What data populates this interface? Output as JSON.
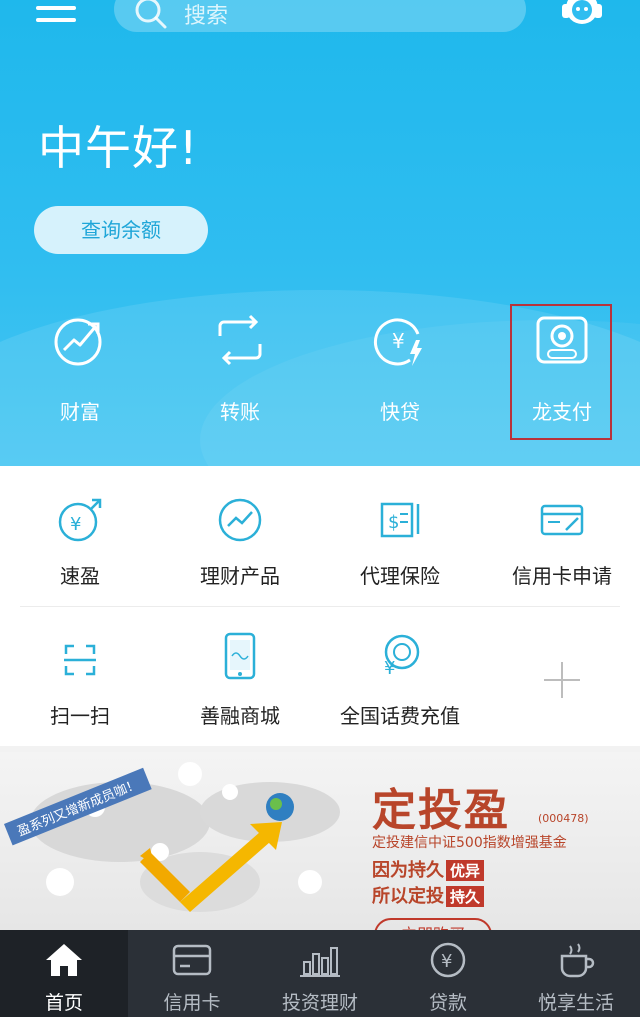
{
  "header": {
    "search_placeholder": "搜索",
    "menu_icon": "hamburger-menu-icon",
    "service_icon": "customer-service-icon"
  },
  "hero": {
    "greeting": "中午好!",
    "balance_button": "查询余额",
    "actions": [
      {
        "label": "财富",
        "icon": "wealth-growth-icon"
      },
      {
        "label": "转账",
        "icon": "transfer-icon"
      },
      {
        "label": "快贷",
        "icon": "quick-loan-icon"
      },
      {
        "label": "龙支付",
        "icon": "dragon-pay-icon",
        "highlighted": true
      }
    ]
  },
  "grid": {
    "row1": [
      {
        "label": "速盈",
        "icon": "su-ying-icon"
      },
      {
        "label": "理财产品",
        "icon": "financial-product-icon"
      },
      {
        "label": "代理保险",
        "icon": "insurance-icon"
      },
      {
        "label": "信用卡申请",
        "icon": "credit-card-apply-icon"
      }
    ],
    "row2": [
      {
        "label": "扫一扫",
        "icon": "scan-icon"
      },
      {
        "label": "善融商城",
        "icon": "mall-phone-icon"
      },
      {
        "label": "全国话费充值",
        "icon": "phone-recharge-icon"
      },
      {
        "label": "",
        "icon": "add-icon"
      }
    ]
  },
  "banner": {
    "ribbon": "盈系列又增新成员咖！",
    "title": "定投盈",
    "code": "(000478)",
    "subtitle": "定投建信中证500指数增强基金",
    "line1_text": "因为持久",
    "line1_tag": "优异",
    "line2_text": "所以定投",
    "line2_tag": "持久",
    "buy_button": "立即购买"
  },
  "bottom_nav": [
    {
      "label": "首页",
      "icon": "home-icon",
      "active": true
    },
    {
      "label": "信用卡",
      "icon": "credit-card-icon",
      "active": false
    },
    {
      "label": "投资理财",
      "icon": "bar-chart-icon",
      "active": false
    },
    {
      "label": "贷款",
      "icon": "yen-coin-icon",
      "active": false
    },
    {
      "label": "悦享生活",
      "icon": "coffee-cup-icon",
      "active": false
    }
  ],
  "colors": {
    "hero_blue": "#1fb8ec",
    "nav_dark": "#2b3037",
    "highlight_red": "#b8333b",
    "icon_teal": "#2bb0d8",
    "banner_red": "#b8452a"
  }
}
